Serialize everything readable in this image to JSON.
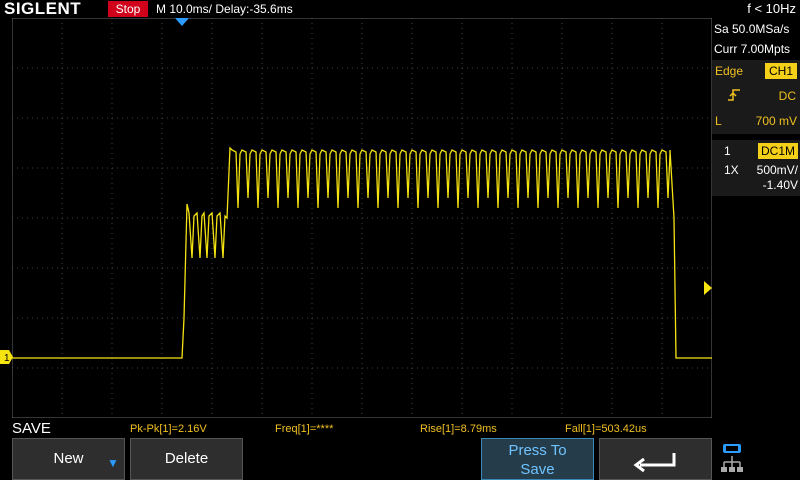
{
  "header": {
    "brand": "SIGLENT",
    "run_status": "Stop",
    "timebase": "M 10.0ms/ Delay:-35.6ms",
    "trigger_freq": "f < 10Hz"
  },
  "acquisition": {
    "sample_rate": "Sa 50.0MSa/s",
    "memory": "Curr 7.00Mpts"
  },
  "trigger": {
    "type_label": "Edge",
    "source": "CH1",
    "slope_icon": "rising-edge-icon",
    "coupling": "DC",
    "level_label": "L",
    "level": "700 mV"
  },
  "channel": {
    "number": "1",
    "coupling": "DC1M",
    "probe": "1X",
    "scale": "500mV/",
    "offset": "-1.40V",
    "marker": "1",
    "color": "#f5e312"
  },
  "measurements": {
    "title": "SAVE",
    "pkpk": "Pk-Pk[1]=2.16V",
    "freq": "Freq[1]=****",
    "rise": "Rise[1]=8.79ms",
    "fall": "Fall[1]=503.42us"
  },
  "menu": {
    "new_label": "New",
    "delete_label": "Delete",
    "press_save_line1": "Press To",
    "press_save_line2": "Save",
    "back_icon": "return-arrow-icon",
    "network_icon": "network-icon"
  },
  "colors": {
    "accent_blue": "#2b9bff",
    "stop_red": "#d0021b",
    "trace_yellow": "#f5e312"
  }
}
